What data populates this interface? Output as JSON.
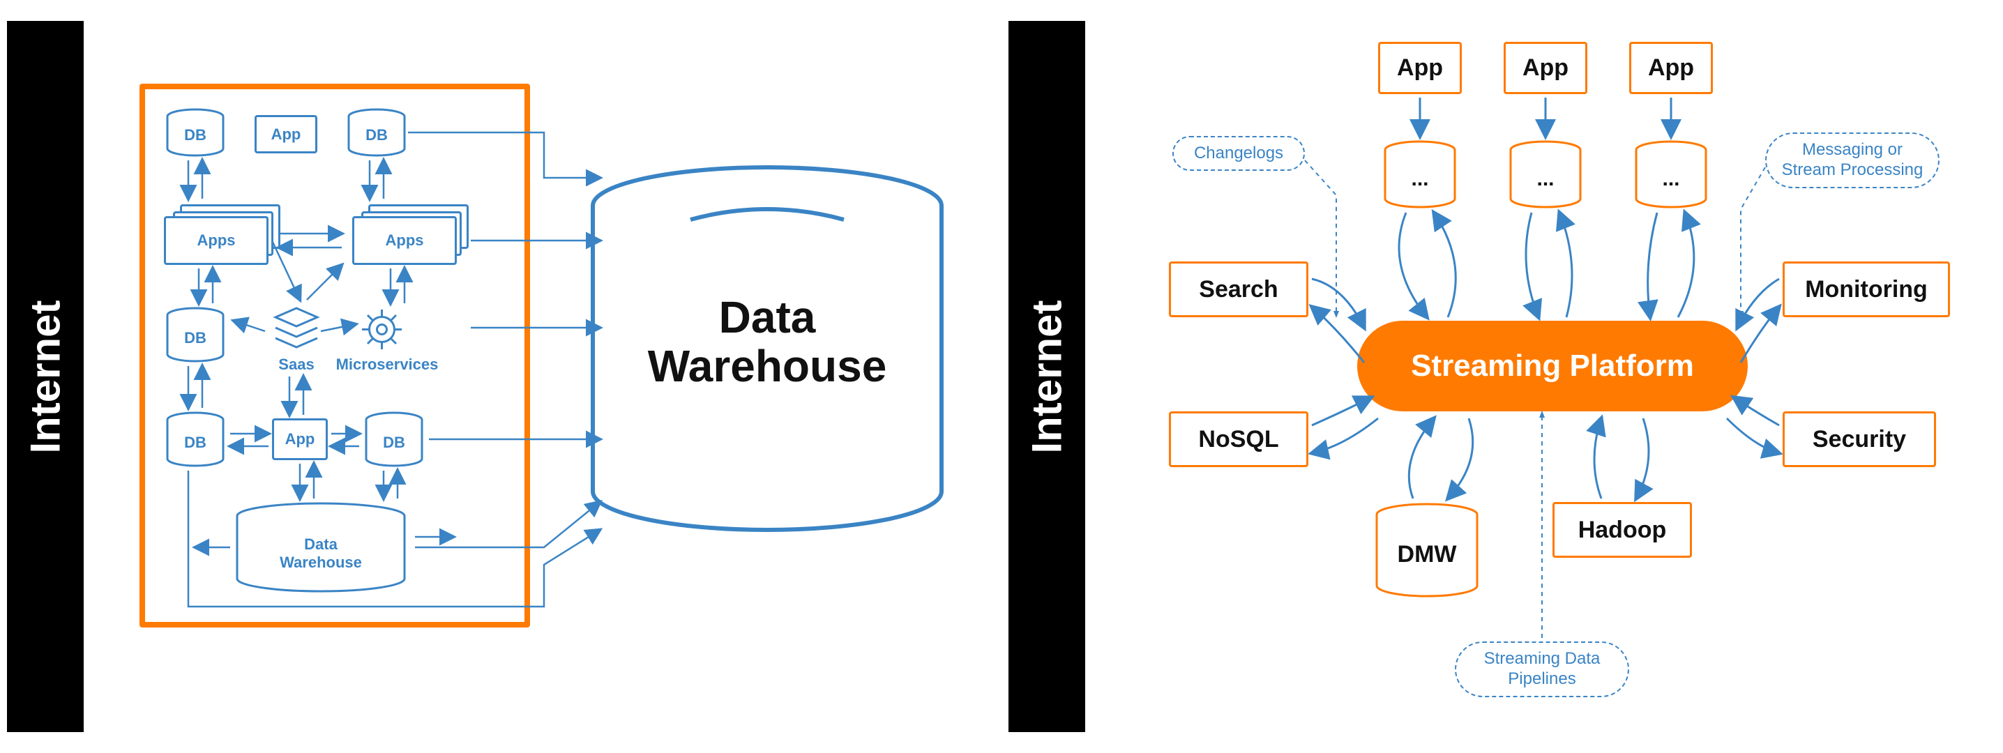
{
  "left": {
    "internet_label": "Internet",
    "nodes": {
      "db1": "DB",
      "app1": "App",
      "db2": "DB",
      "apps1": "Apps",
      "apps2": "Apps",
      "db3": "DB",
      "saas": "Saas",
      "microservices": "Microservices",
      "db4": "DB",
      "app2": "App",
      "db5": "DB",
      "dw_small_line1": "Data",
      "dw_small_line2": "Warehouse"
    },
    "dw_line1": "Data",
    "dw_line2": "Warehouse"
  },
  "right": {
    "internet_label": "Internet",
    "apps": [
      "App",
      "App",
      "App"
    ],
    "cyl_labels": [
      "...",
      "...",
      "..."
    ],
    "search": "Search",
    "nosql": "NoSQL",
    "monitoring": "Monitoring",
    "security": "Security",
    "dmw": "DMW",
    "hadoop": "Hadoop",
    "platform": "Streaming Platform",
    "changelogs": "Changelogs",
    "messaging_line1": "Messaging or",
    "messaging_line2": "Stream Processing",
    "pipelines_line1": "Streaming Data",
    "pipelines_line2": "Pipelines"
  }
}
